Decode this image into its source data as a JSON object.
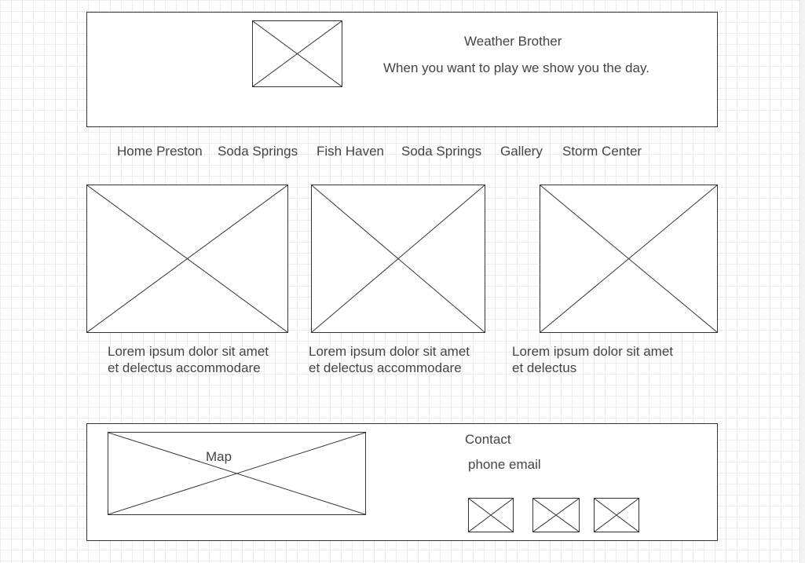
{
  "header": {
    "site_title": "Weather Brother",
    "tagline": "When you want to play we show you the day.",
    "logo_icon": "image-placeholder-icon"
  },
  "nav": {
    "items": [
      {
        "label": "Home Preston"
      },
      {
        "label": "Soda Springs"
      },
      {
        "label": "Fish Haven"
      },
      {
        "label": "Soda Springs"
      },
      {
        "label": "Gallery"
      },
      {
        "label": "Storm Center"
      }
    ]
  },
  "cards": [
    {
      "line1": "Lorem ipsum dolor sit amet",
      "line2": "et delectus accommodare",
      "icon": "image-placeholder-icon"
    },
    {
      "line1": "Lorem ipsum dolor sit amet",
      "line2": "et delectus accommodare",
      "icon": "image-placeholder-icon"
    },
    {
      "line1": "Lorem ipsum dolor sit amet",
      "line2": "et delectus",
      "icon": "image-placeholder-icon"
    }
  ],
  "footer": {
    "map_label": "Map",
    "contact_title": "Contact",
    "contact_details": "phone email",
    "social_icons": [
      "image-placeholder-icon",
      "image-placeholder-icon",
      "image-placeholder-icon"
    ]
  },
  "colors": {
    "stroke": "#333333",
    "text": "#444444",
    "grid": "#ececec",
    "background": "#ffffff"
  }
}
